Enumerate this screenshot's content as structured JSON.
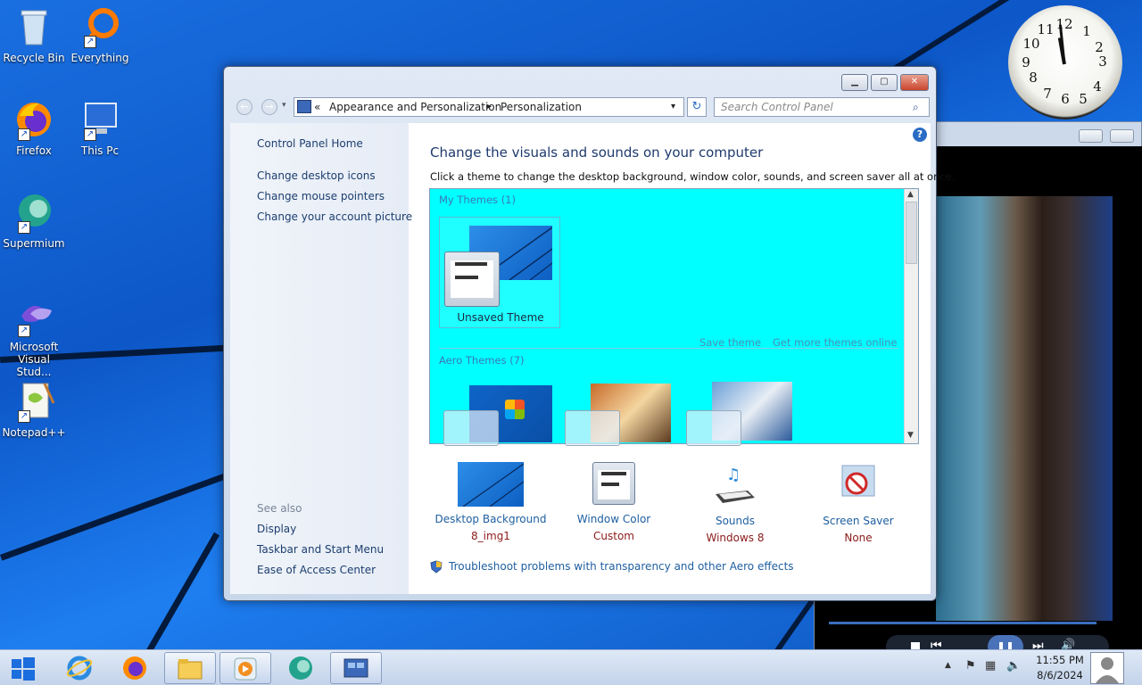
{
  "desktop": {
    "icons": [
      {
        "label": "Recycle Bin"
      },
      {
        "label": "Everything"
      },
      {
        "label": "Firefox"
      },
      {
        "label": "This Pc"
      },
      {
        "label": "Supermium"
      },
      {
        "label": "Microsoft Visual Stud..."
      },
      {
        "label": "Notepad++"
      }
    ]
  },
  "clock_gadget": {
    "numbers": [
      "12",
      "1",
      "2",
      "3",
      "4",
      "5",
      "6",
      "7",
      "8",
      "9",
      "10",
      "11"
    ]
  },
  "window": {
    "breadcrumb": {
      "root_chevron": "«",
      "item1": "Appearance and Personalization",
      "separator": "▸",
      "item2": "Personalization"
    },
    "search_placeholder": "Search Control Panel",
    "left_pane": {
      "home": "Control Panel Home",
      "tasks": [
        "Change desktop icons",
        "Change mouse pointers",
        "Change your account picture"
      ],
      "see_also_heading": "See also",
      "see_also": [
        "Display",
        "Taskbar and Start Menu",
        "Ease of Access Center"
      ]
    },
    "main": {
      "heading": "Change the visuals and sounds on your computer",
      "description": "Click a theme to change the desktop background, window color, sounds, and screen saver all at once.",
      "my_themes_heading": "My Themes (1)",
      "unsaved_theme": "Unsaved Theme",
      "save_theme": "Save theme",
      "get_more": "Get more themes online",
      "aero_heading": "Aero Themes (7)",
      "settings": [
        {
          "title": "Desktop Background",
          "value": "8_img1"
        },
        {
          "title": "Window Color",
          "value": "Custom"
        },
        {
          "title": "Sounds",
          "value": "Windows 8"
        },
        {
          "title": "Screen Saver",
          "value": "None"
        }
      ],
      "troubleshoot": "Troubleshoot problems with transparency and other Aero effects"
    }
  },
  "taskbar": {
    "time": "11:55 PM",
    "date": "8/6/2024"
  },
  "colors": {
    "themes_bg": "#00ffff",
    "link": "#1f5fa0",
    "value_red": "#8b1a1a"
  }
}
